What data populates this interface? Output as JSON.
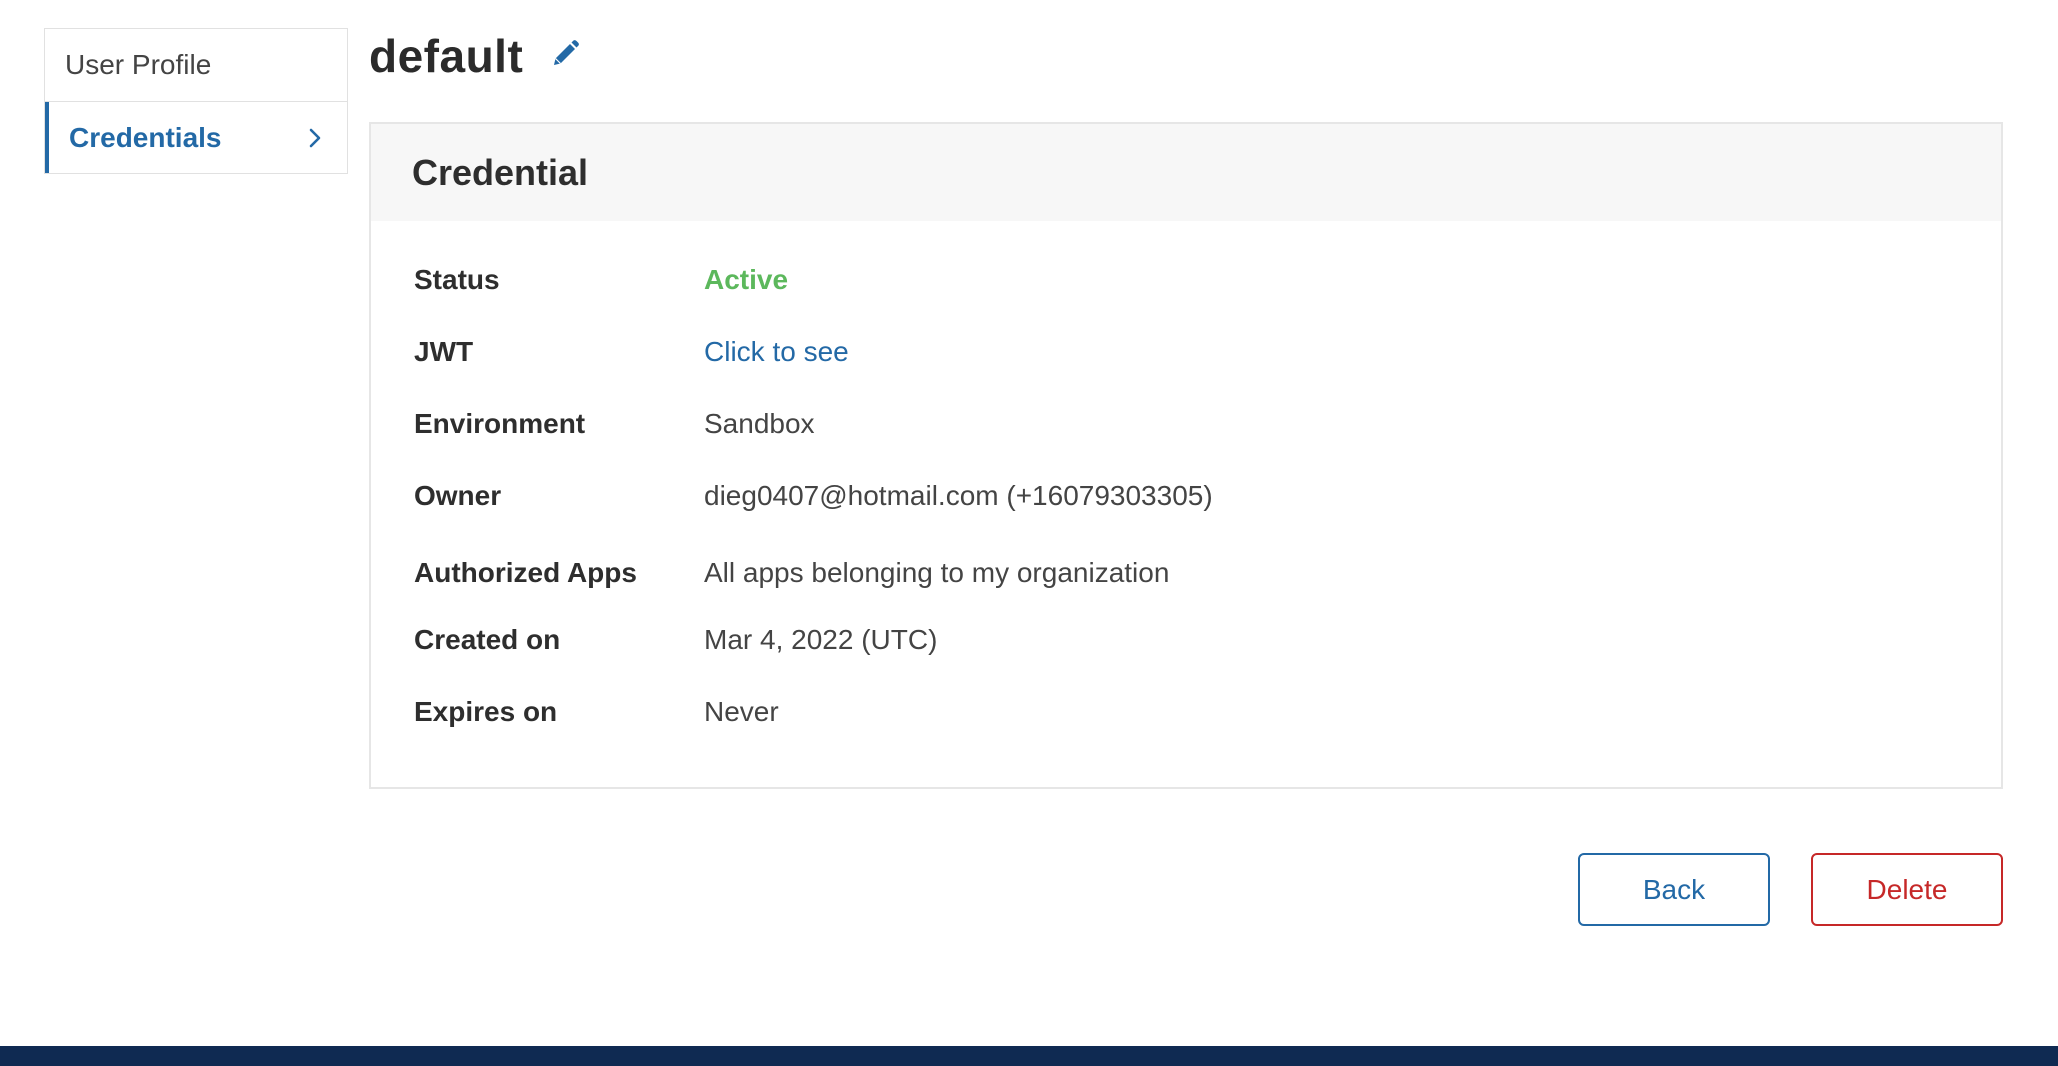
{
  "sidebar": {
    "items": [
      {
        "label": "User Profile",
        "active": false
      },
      {
        "label": "Credentials",
        "active": true
      }
    ]
  },
  "page": {
    "title": "default"
  },
  "card": {
    "title": "Credential",
    "fields": {
      "status": {
        "label": "Status",
        "value": "Active"
      },
      "jwt": {
        "label": "JWT",
        "value": "Click to see"
      },
      "environment": {
        "label": "Environment",
        "value": "Sandbox"
      },
      "owner": {
        "label": "Owner",
        "value": "dieg0407@hotmail.com (+16079303305)"
      },
      "authorized_apps": {
        "label": "Authorized Apps",
        "value": "All apps belonging to my organization"
      },
      "created_on": {
        "label": "Created on",
        "value": "Mar 4, 2022 (UTC)"
      },
      "expires_on": {
        "label": "Expires on",
        "value": "Never"
      }
    }
  },
  "actions": {
    "back_label": "Back",
    "delete_label": "Delete"
  },
  "colors": {
    "primary": "#2369a6",
    "status_active": "#5cb85c",
    "danger": "#c62828",
    "footer": "#0f2a52"
  },
  "icons": {
    "edit": "pencil-icon",
    "chevron": "chevron-right-icon"
  }
}
